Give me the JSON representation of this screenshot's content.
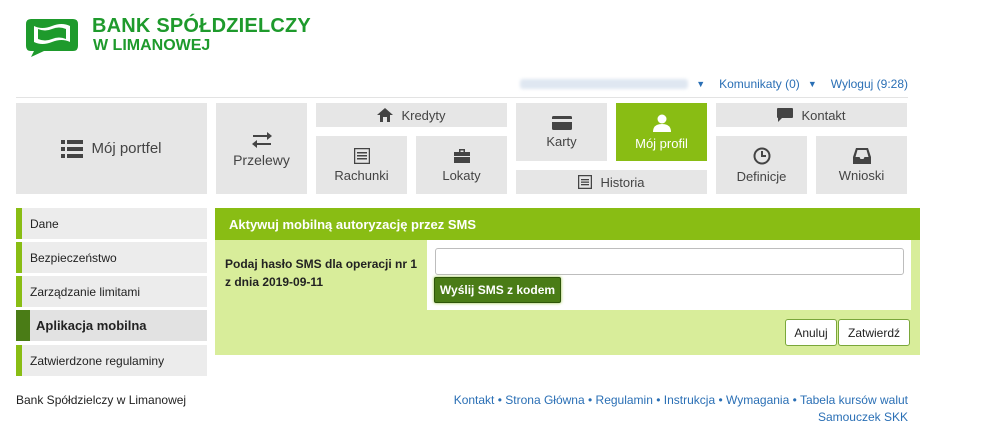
{
  "brand": {
    "line1": "BANK SPÓŁDZIELCZY",
    "line2": "W LIMANOWEJ",
    "color": "#1e9a2c"
  },
  "topbar": {
    "user_menu_icon": "caret-down",
    "messages": "Komunikaty (0)",
    "logout": "Wyloguj (9:28)"
  },
  "nav": {
    "portfel": "Mój portfel",
    "przelewy": "Przelewy",
    "kredyty": "Kredyty",
    "rachunki": "Rachunki",
    "lokaty": "Lokaty",
    "karty": "Karty",
    "moj_profil": "Mój profil",
    "historia": "Historia",
    "kontakt": "Kontakt",
    "definicje": "Definicje",
    "wnioski": "Wnioski",
    "active": "Mój profil",
    "accent": "#89bd14"
  },
  "sidebar": {
    "items": [
      {
        "label": "Dane"
      },
      {
        "label": "Bezpieczeństwo"
      },
      {
        "label": "Zarządzanie limitami"
      },
      {
        "label": "Aplikacja mobilna"
      },
      {
        "label": "Zatwierdzone regulaminy"
      }
    ],
    "active": "Aplikacja mobilna"
  },
  "panel": {
    "title": "Aktywuj mobilną autoryzację przez SMS",
    "label": "Podaj hasło SMS dla operacji nr 1 z dnia 2019-09-11",
    "input_value": "",
    "send_button": "Wyślij SMS z kodem",
    "cancel_button": "Anuluj",
    "confirm_button": "Zatwierdź"
  },
  "footer": {
    "bank": "Bank Spółdzielczy w Limanowej",
    "links": [
      "Kontakt",
      "Strona Główna",
      "Regulamin",
      "Instrukcja",
      "Wymagania",
      "Tabela kursów walut",
      "Samouczek SKK"
    ]
  }
}
